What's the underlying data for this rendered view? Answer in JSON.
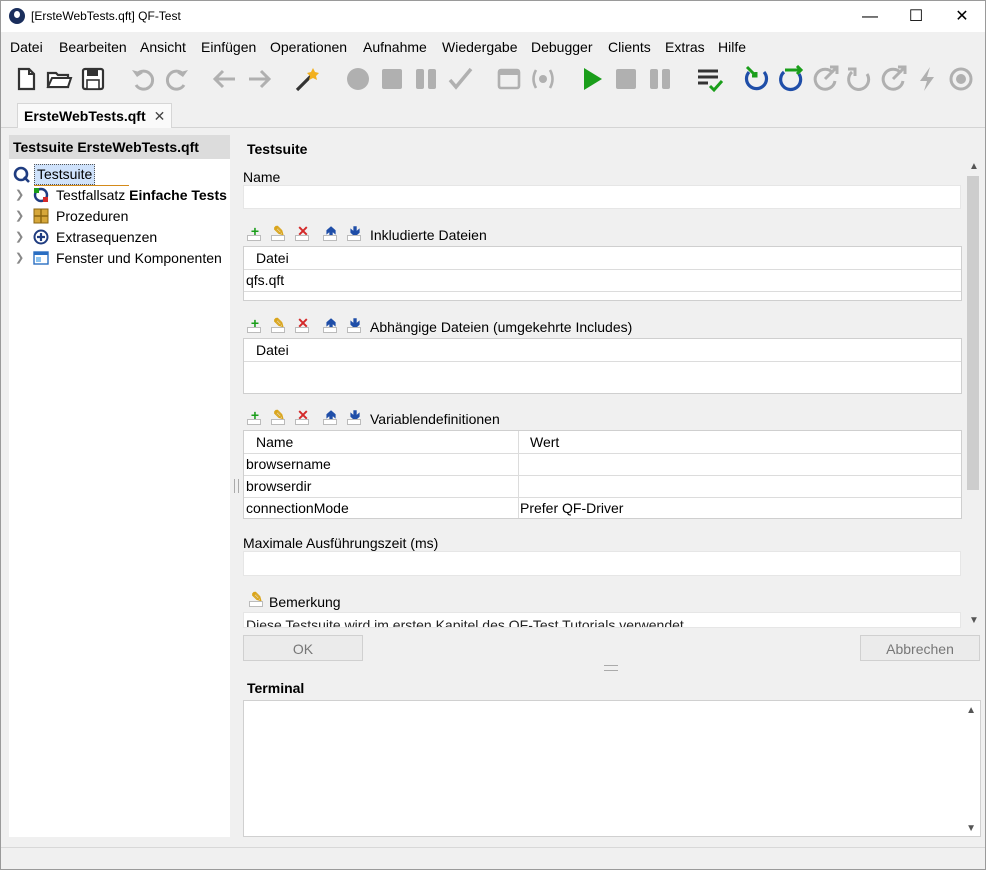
{
  "window": {
    "title": "[ErsteWebTests.qft] QF-Test"
  },
  "menu": [
    "Datei",
    "Bearbeiten",
    "Ansicht",
    "Einfügen",
    "Operationen",
    "Aufnahme",
    "Wiedergabe",
    "Debugger",
    "Clients",
    "Extras",
    "Hilfe"
  ],
  "toolbar": {
    "icons": [
      "new-file-icon",
      "open-folder-icon",
      "save-icon",
      "undo-icon",
      "redo-icon",
      "back-icon",
      "forward-icon",
      "magic-wand-icon",
      "record-icon",
      "stop-record-icon",
      "pause-record-icon",
      "check-icon",
      "window-icon",
      "component-icon",
      "play-icon",
      "stop-icon",
      "pause-icon",
      "list-check-icon",
      "step-in-icon",
      "step-over-icon",
      "step-out-icon",
      "skip-icon",
      "continue-icon",
      "break-icon",
      "breakpoint-icon"
    ]
  },
  "tabs": [
    {
      "label": "ErsteWebTests.qft",
      "close": "✕"
    }
  ],
  "tree": {
    "header": "Testsuite ErsteWebTests.qft",
    "root": "Testsuite",
    "items": [
      {
        "prefix": "Testfallsatz ",
        "bold": "Einfache Tests",
        "icon": "testcase-set-icon"
      },
      {
        "prefix": "Prozeduren",
        "bold": "",
        "icon": "procedures-icon"
      },
      {
        "prefix": "Extrasequenzen",
        "bold": "",
        "icon": "extras-icon"
      },
      {
        "prefix": "Fenster und Komponenten",
        "bold": "",
        "icon": "windows-components-icon"
      }
    ]
  },
  "detail": {
    "heading": "Testsuite",
    "name_label": "Name",
    "name_value": "",
    "included": {
      "label": "Inkludierte Dateien",
      "columns": [
        "Datei"
      ],
      "rows": [
        [
          "qfs.qft"
        ]
      ]
    },
    "dependent": {
      "label": "Abhängige Dateien (umgekehrte Includes)",
      "columns": [
        "Datei"
      ],
      "rows": []
    },
    "variables": {
      "label": "Variablendefinitionen",
      "columns": [
        "Name",
        "Wert"
      ],
      "rows": [
        [
          "browsername",
          ""
        ],
        [
          "browserdir",
          ""
        ],
        [
          "connectionMode",
          "Prefer QF-Driver"
        ]
      ]
    },
    "max_time_label": "Maximale Ausführungszeit (ms)",
    "max_time_value": "",
    "comment_label": "Bemerkung",
    "comment_text": "Diese Testsuite wird im ersten Kapitel des QF-Test Tutorials verwendet.",
    "ok_label": "OK",
    "cancel_label": "Abbrechen"
  },
  "terminal": {
    "heading": "Terminal"
  },
  "colors": {
    "accent_green": "#1a9e1a",
    "accent_blue": "#1f4ea8",
    "disabled_gray": "#b0b0b0"
  }
}
